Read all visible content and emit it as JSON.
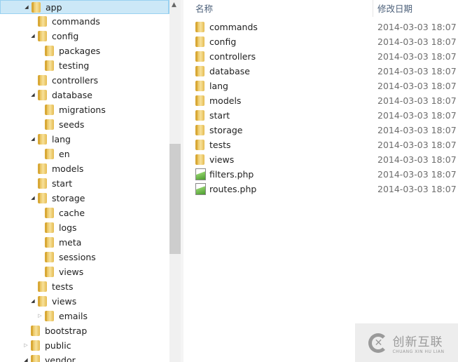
{
  "tree": [
    {
      "label": "app",
      "level": 0,
      "expander": "open",
      "selected": true
    },
    {
      "label": "commands",
      "level": 1,
      "expander": "none"
    },
    {
      "label": "config",
      "level": 1,
      "expander": "open"
    },
    {
      "label": "packages",
      "level": 2,
      "expander": "none"
    },
    {
      "label": "testing",
      "level": 2,
      "expander": "none"
    },
    {
      "label": "controllers",
      "level": 1,
      "expander": "none"
    },
    {
      "label": "database",
      "level": 1,
      "expander": "open"
    },
    {
      "label": "migrations",
      "level": 2,
      "expander": "none"
    },
    {
      "label": "seeds",
      "level": 2,
      "expander": "none"
    },
    {
      "label": "lang",
      "level": 1,
      "expander": "open"
    },
    {
      "label": "en",
      "level": 2,
      "expander": "none"
    },
    {
      "label": "models",
      "level": 1,
      "expander": "none"
    },
    {
      "label": "start",
      "level": 1,
      "expander": "none"
    },
    {
      "label": "storage",
      "level": 1,
      "expander": "open"
    },
    {
      "label": "cache",
      "level": 2,
      "expander": "none"
    },
    {
      "label": "logs",
      "level": 2,
      "expander": "none"
    },
    {
      "label": "meta",
      "level": 2,
      "expander": "none"
    },
    {
      "label": "sessions",
      "level": 2,
      "expander": "none"
    },
    {
      "label": "views",
      "level": 2,
      "expander": "none"
    },
    {
      "label": "tests",
      "level": 1,
      "expander": "none"
    },
    {
      "label": "views",
      "level": 1,
      "expander": "open"
    },
    {
      "label": "emails",
      "level": 2,
      "expander": "closed"
    },
    {
      "label": "bootstrap",
      "level": 0,
      "expander": "none"
    },
    {
      "label": "public",
      "level": 0,
      "expander": "closed"
    },
    {
      "label": "vendor",
      "level": 0,
      "expander": "open"
    }
  ],
  "list": {
    "headers": {
      "name": "名称",
      "modified": "修改日期"
    },
    "items": [
      {
        "name": "commands",
        "type": "folder",
        "modified": "2014-03-03 18:07"
      },
      {
        "name": "config",
        "type": "folder",
        "modified": "2014-03-03 18:07"
      },
      {
        "name": "controllers",
        "type": "folder",
        "modified": "2014-03-03 18:07"
      },
      {
        "name": "database",
        "type": "folder",
        "modified": "2014-03-03 18:07"
      },
      {
        "name": "lang",
        "type": "folder",
        "modified": "2014-03-03 18:07"
      },
      {
        "name": "models",
        "type": "folder",
        "modified": "2014-03-03 18:07"
      },
      {
        "name": "start",
        "type": "folder",
        "modified": "2014-03-03 18:07"
      },
      {
        "name": "storage",
        "type": "folder",
        "modified": "2014-03-03 18:07"
      },
      {
        "name": "tests",
        "type": "folder",
        "modified": "2014-03-03 18:07"
      },
      {
        "name": "views",
        "type": "folder",
        "modified": "2014-03-03 18:07"
      },
      {
        "name": "filters.php",
        "type": "php-file",
        "modified": "2014-03-03 18:07"
      },
      {
        "name": "routes.php",
        "type": "php-file",
        "modified": "2014-03-03 18:07"
      }
    ]
  },
  "watermark": {
    "cn": "创新互联",
    "en": "CHUANG XIN HU LIAN"
  }
}
